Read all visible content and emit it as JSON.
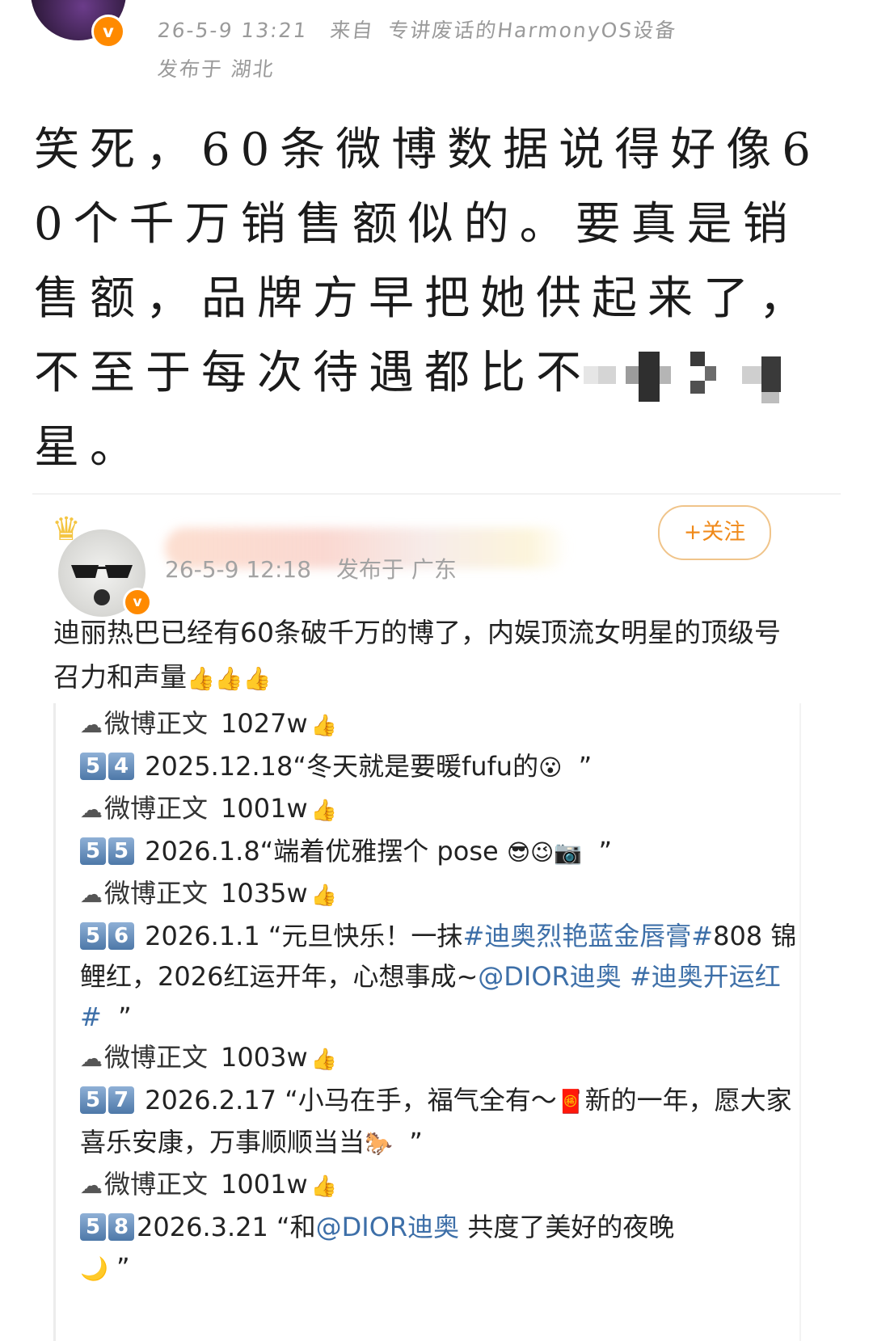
{
  "post": {
    "timestamp": "26-5-9 13:21",
    "from_label": "来自",
    "device": "专讲废话的HarmonyOS设备",
    "location": "发布于 湖北",
    "text_before_mosaic": "笑死，60条微博数据说得好像60个千万销售额似的。要真是销售额，品牌方早把她供起来了，不至于每次待遇都比不",
    "text_after_mosaic": "星。"
  },
  "quoted": {
    "follow_label": "+关注",
    "timestamp": "26-5-9 12:18",
    "location": "发布于 广东",
    "text": "迪丽热巴已经有60条破千万的博了，内娱顶流女明星的顶级号召力和声量",
    "text_emoji": "👍👍👍",
    "items": [
      {
        "label": "微博正文",
        "count": "1027w"
      },
      {
        "keys": [
          "5",
          "4"
        ],
        "date": "2025.12.18",
        "body": "“冬天就是要暖fufu的",
        "emoji": "😮",
        "tail": "”"
      },
      {
        "label": "微博正文",
        "count": "1001w"
      },
      {
        "keys": [
          "5",
          "5"
        ],
        "date": "2026.1.8",
        "body": "“端着优雅摆个 pose",
        "emoji": "😎😉📷",
        "tail": "”"
      },
      {
        "label": "微博正文",
        "count": "1035w"
      },
      {
        "keys": [
          "5",
          "6"
        ],
        "date": "2026.1.1",
        "body": "“元旦快乐！一抹",
        "link1": "#迪奥烈艳蓝金唇膏#",
        "body2": "808 锦鲤红，2026红运开年，心想事成~",
        "link2": "@DIOR迪奥",
        "link3": "#迪奥开运红#",
        "tail": "”"
      },
      {
        "label": "微博正文",
        "count": "1003w"
      },
      {
        "keys": [
          "5",
          "7"
        ],
        "date": "2026.2.17",
        "body": "“小马在手，福气全有～",
        "emoji": "🧧",
        "body2": "新的一年，愿大家喜乐安康，万事顺顺当当",
        "emoji2": "🐎",
        "tail": "”"
      },
      {
        "label": "微博正文",
        "count": "1001w"
      },
      {
        "keys": [
          "5",
          "8"
        ],
        "date": "2026.3.21",
        "body": "“和",
        "link1": "@DIOR迪奥",
        "body2": " 共度了美好的夜晚",
        "emoji": "🌙",
        "tail": "”"
      }
    ]
  },
  "icons": {
    "verified": "v-badge-icon",
    "crown": "crown-icon",
    "cloud": "weibo-cloud-icon",
    "thumbs": "thumbs-up-icon"
  },
  "colors": {
    "meta": "#9a9a9a",
    "verified": "#ff8a00",
    "follow": "#f08a1a",
    "link": "#3d6fa8",
    "keycap": "#4d78a8"
  }
}
